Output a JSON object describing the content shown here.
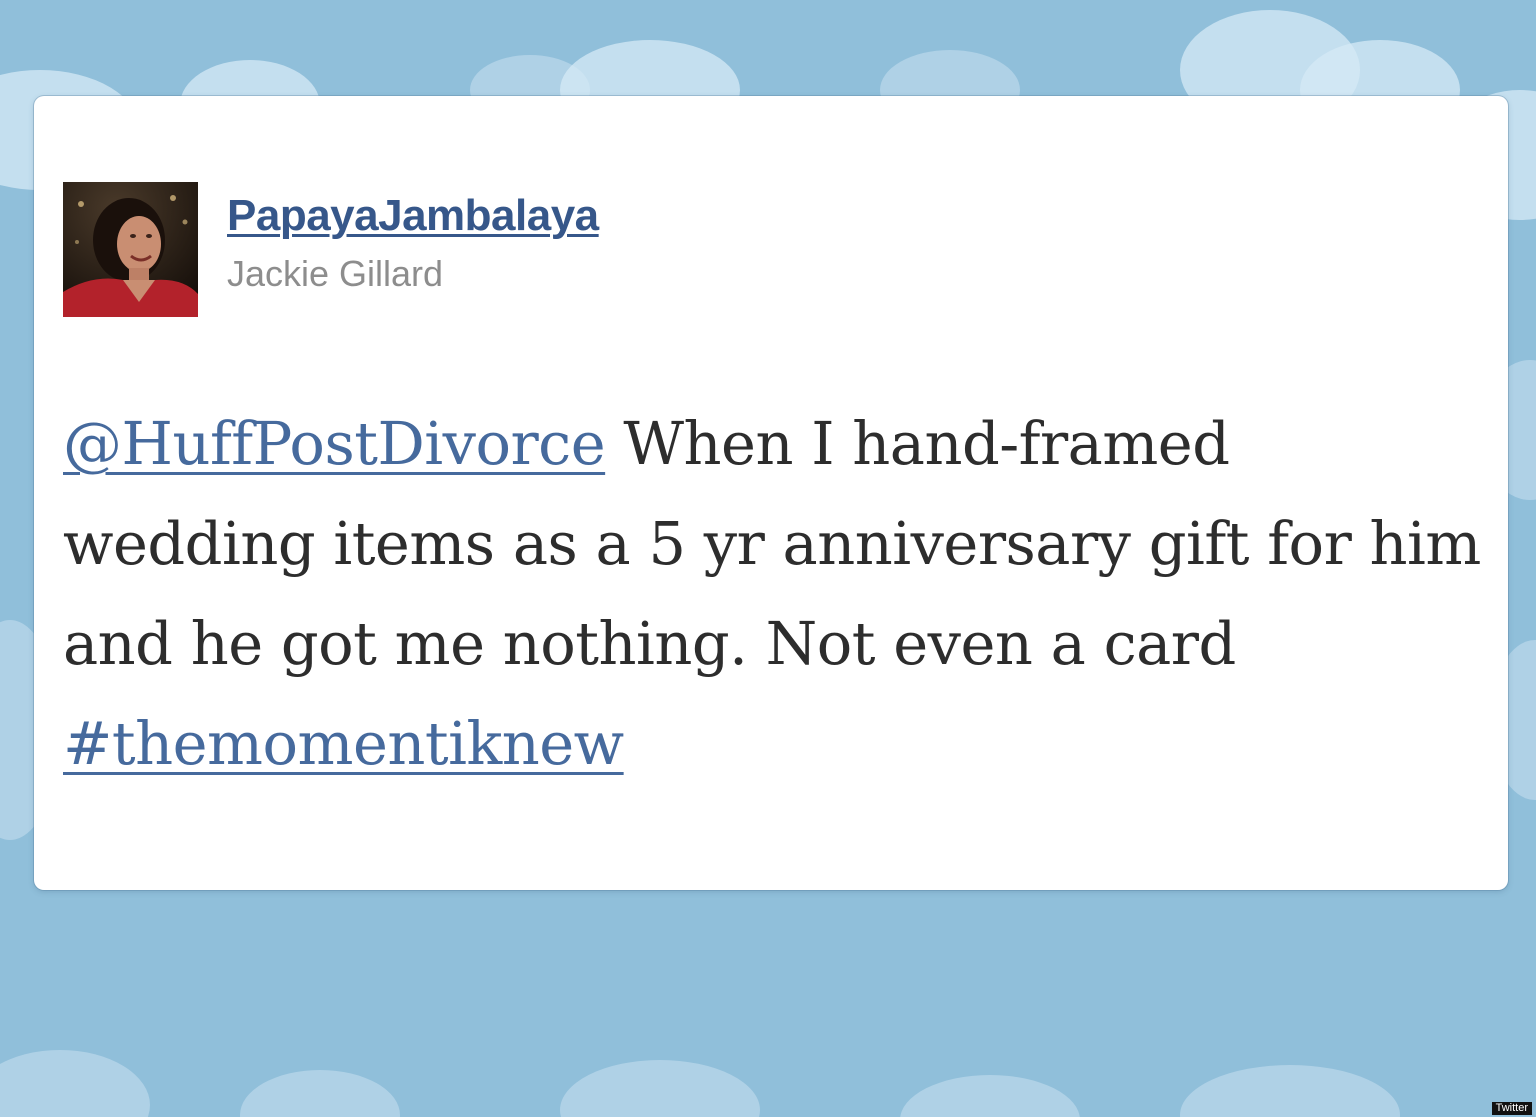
{
  "colors": {
    "background": "#90bfda",
    "cloud": "#d6e9f5",
    "card": "#ffffff",
    "screen_name": "#36578a",
    "full_name": "#8d8d8d",
    "text": "#2d2d2d",
    "link": "#466a9d"
  },
  "tweet": {
    "avatar_icon": "profile-photo",
    "screen_name": "PapayaJambalaya",
    "full_name": "Jackie Gillard",
    "mention": "@HuffPostDivorce",
    "text_main": " When I hand-framed wedding items as a 5 yr anniversary gift for him and he got me nothing. Not even a card ",
    "hashtag": "#themomentiknew"
  },
  "credit": "Twitter"
}
